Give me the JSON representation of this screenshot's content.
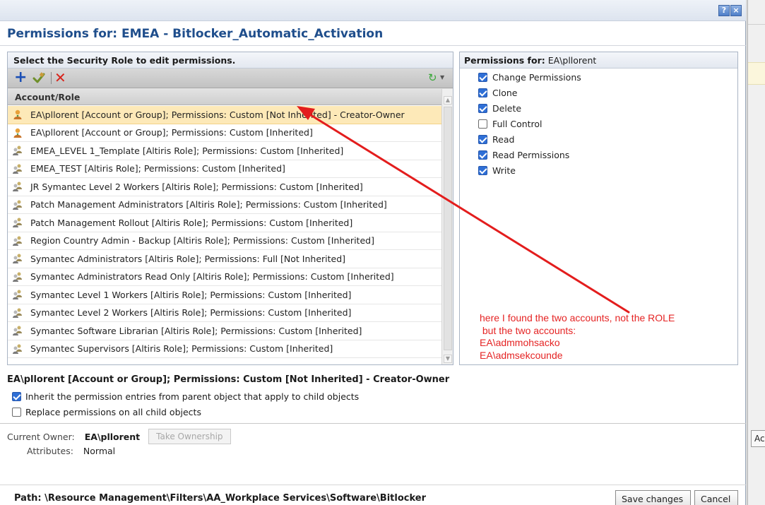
{
  "dialog": {
    "title": "Permissions for: EMEA - Bitlocker_Automatic_Activation",
    "help_glyph": "?",
    "close_glyph": "×"
  },
  "left_panel": {
    "header": "Select the Security Role to edit permissions.",
    "column_header": "Account/Role",
    "toolbar": {
      "add_icon": "plus-icon",
      "edit_icon": "edit-icon",
      "delete_icon": "delete-icon",
      "refresh_icon": "refresh-icon"
    },
    "rows": [
      {
        "text": "EA\\pllorent [Account or Group]; Permissions: Custom [Not Inherited] - Creator-Owner",
        "icon": "user-icon",
        "selected": true
      },
      {
        "text": "EA\\pllorent [Account or Group]; Permissions: Custom [Inherited]",
        "icon": "user-icon",
        "selected": false
      },
      {
        "text": "EMEA_LEVEL 1_Template [Altiris Role]; Permissions: Custom [Inherited]",
        "icon": "role-icon",
        "selected": false
      },
      {
        "text": "EMEA_TEST [Altiris Role]; Permissions: Custom [Inherited]",
        "icon": "role-icon",
        "selected": false
      },
      {
        "text": "JR Symantec Level 2 Workers [Altiris Role]; Permissions: Custom [Inherited]",
        "icon": "role-icon",
        "selected": false
      },
      {
        "text": "Patch Management Administrators [Altiris Role]; Permissions: Custom [Inherited]",
        "icon": "role-icon",
        "selected": false
      },
      {
        "text": "Patch Management Rollout [Altiris Role]; Permissions: Custom [Inherited]",
        "icon": "role-icon",
        "selected": false
      },
      {
        "text": "Region Country Admin - Backup [Altiris Role]; Permissions: Custom [Inherited]",
        "icon": "role-icon",
        "selected": false
      },
      {
        "text": "Symantec Administrators [Altiris Role]; Permissions: Full [Not Inherited]",
        "icon": "role-icon",
        "selected": false
      },
      {
        "text": "Symantec Administrators Read Only [Altiris Role]; Permissions: Custom [Inherited]",
        "icon": "role-icon",
        "selected": false
      },
      {
        "text": "Symantec Level 1 Workers [Altiris Role]; Permissions: Custom [Inherited]",
        "icon": "role-icon",
        "selected": false
      },
      {
        "text": "Symantec Level 2 Workers [Altiris Role]; Permissions: Custom [Inherited]",
        "icon": "role-icon",
        "selected": false
      },
      {
        "text": "Symantec Software Librarian [Altiris Role]; Permissions: Custom [Inherited]",
        "icon": "role-icon",
        "selected": false
      },
      {
        "text": "Symantec Supervisors [Altiris Role]; Permissions: Custom [Inherited]",
        "icon": "role-icon",
        "selected": false
      }
    ]
  },
  "right_panel": {
    "header_label": "Permissions for:",
    "header_account": "EA\\pllorent",
    "permissions": [
      {
        "label": "Change Permissions",
        "checked": true
      },
      {
        "label": "Clone",
        "checked": true
      },
      {
        "label": "Delete",
        "checked": true
      },
      {
        "label": "Full Control",
        "checked": false
      },
      {
        "label": "Read",
        "checked": true
      },
      {
        "label": "Read Permissions",
        "checked": true
      },
      {
        "label": "Write",
        "checked": true
      }
    ]
  },
  "annotation": {
    "text": "here I found the two accounts, not the ROLE\n but the two accounts:\nEA\\admmohsacko\nEA\\admsekcounde",
    "color": "#e52424"
  },
  "selection": {
    "title": "EA\\pllorent [Account or Group]; Permissions: Custom [Not Inherited] - Creator-Owner",
    "inherit_label": "Inherit the permission entries from parent object that apply to child objects",
    "inherit_checked": true,
    "replace_label": "Replace permissions on all child objects",
    "replace_checked": false
  },
  "owner": {
    "label": "Current Owner:",
    "value": "EA\\pllorent",
    "take_button": "Take Ownership",
    "attributes_label": "Attributes:",
    "attributes_value": "Normal"
  },
  "footer": {
    "path": "Path: \\Resource Management\\Filters\\AA_Workplace Services\\Software\\Bitlocker",
    "save_button": "Save changes",
    "cancel_button": "Cancel"
  },
  "background": {
    "button_fragment": "Ac"
  }
}
